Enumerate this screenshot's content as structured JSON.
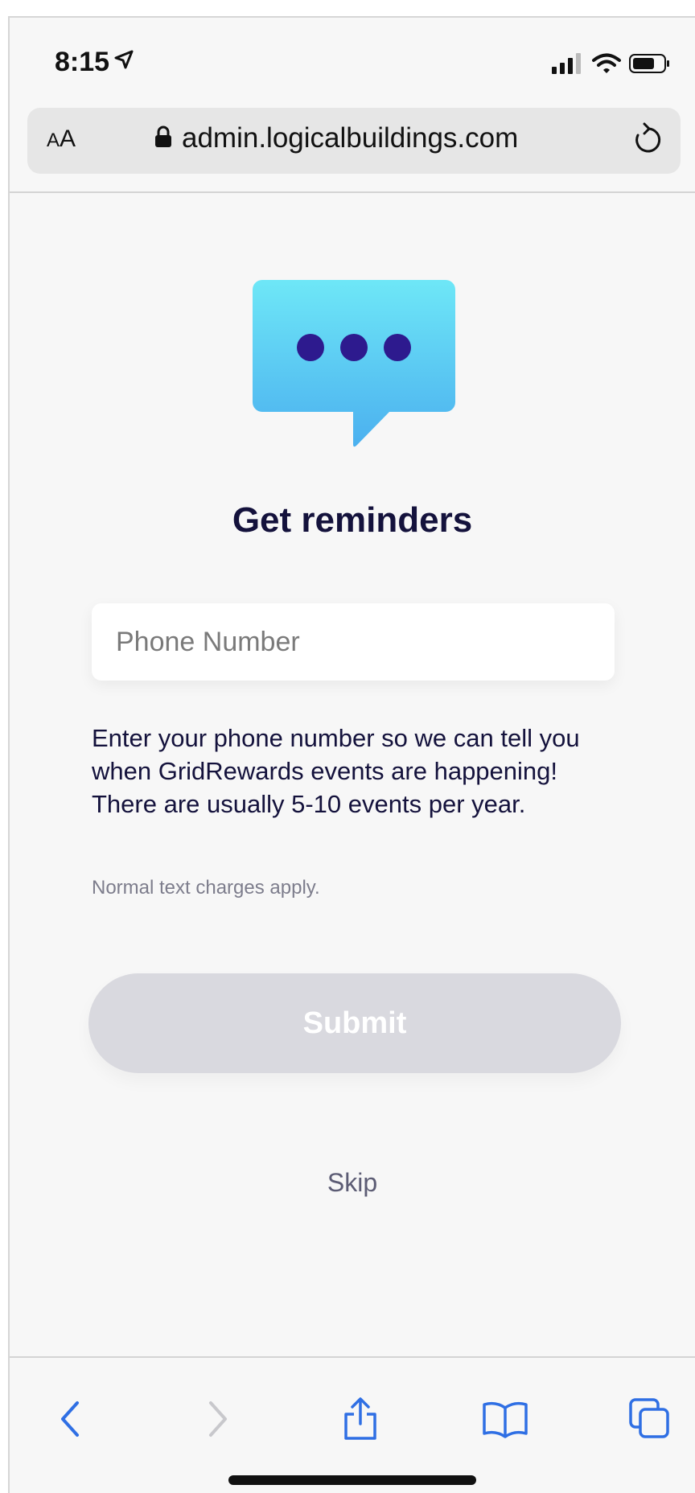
{
  "status_bar": {
    "time": "8:15",
    "icons": [
      "location-arrow-icon",
      "cellular-signal-icon",
      "wifi-icon",
      "battery-icon"
    ]
  },
  "address_bar": {
    "text_size_label_small": "A",
    "text_size_label_large": "A",
    "url": "admin.logicalbuildings.com",
    "lock_icon": "lock-icon",
    "reload_icon": "reload-icon"
  },
  "content": {
    "illustration": "chat-bubble-icon",
    "title": "Get reminders",
    "phone_placeholder": "Phone Number",
    "phone_value": "",
    "description": "Enter your phone number so we can tell you when GridRewards events are happening! There are usually 5-10 events per year.",
    "note": "Normal text charges apply.",
    "submit_label": "Submit",
    "skip_label": "Skip"
  },
  "toolbar": {
    "icons": [
      "back-icon",
      "forward-icon",
      "share-icon",
      "bookmarks-icon",
      "tabs-icon"
    ]
  },
  "colors": {
    "accent": "#2f6fe4",
    "title": "#14123c",
    "submit_disabled": "#d9d9df",
    "bubble_top": "#6ee7f7",
    "bubble_bottom": "#4bb0ef",
    "dots": "#2d1a8e"
  }
}
